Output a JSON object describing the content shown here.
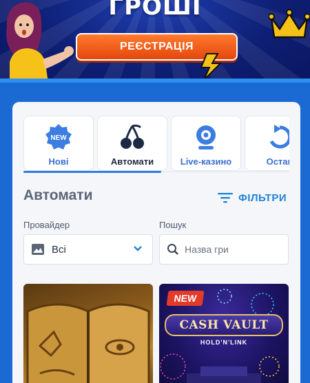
{
  "banner": {
    "title": "ГРОШІ",
    "register_label": "РЕЄСТРАЦІЯ"
  },
  "tabs": [
    {
      "label": "Нові",
      "icon": "new-badge-icon",
      "active": false
    },
    {
      "label": "Автомати",
      "icon": "cherries-icon",
      "active": true
    },
    {
      "label": "Live-казино",
      "icon": "webcam-icon",
      "active": false
    },
    {
      "label": "Остан",
      "icon": "history-icon",
      "active": false
    }
  ],
  "tab_new_badge_text": "NEW",
  "section": {
    "title": "Автомати",
    "filters_label": "ФІЛЬТРИ"
  },
  "provider": {
    "label": "Провайдер",
    "value": "Всі"
  },
  "search": {
    "label": "Пошук",
    "placeholder": "Назва гри"
  },
  "games": [
    {
      "name": "",
      "badge": ""
    },
    {
      "name": "CASH VAULT",
      "subtitle": "HOLD'N'LINK",
      "badge": "NEW"
    }
  ],
  "colors": {
    "primary_blue": "#1b6ad3",
    "accent_orange": "#e4470d",
    "link_blue": "#1f84d6",
    "badge_red": "#e33a2a"
  }
}
